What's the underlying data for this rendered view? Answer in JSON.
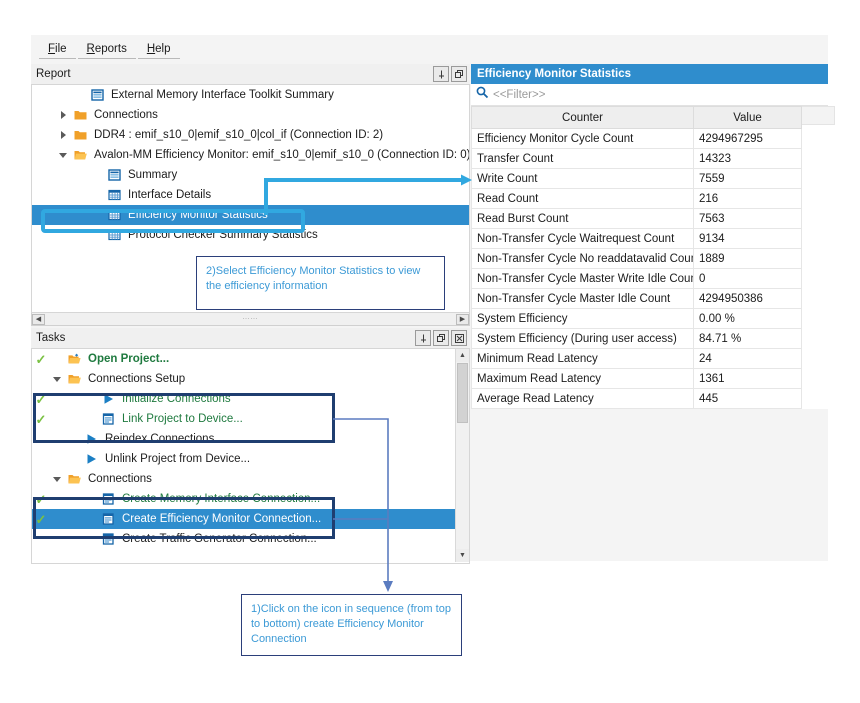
{
  "menu": {
    "items": [
      {
        "label": "File",
        "accel": "F"
      },
      {
        "label": "Reports",
        "accel": "R"
      },
      {
        "label": "Help",
        "accel": "H"
      }
    ]
  },
  "report_panel": {
    "title": "Report",
    "buttons": [
      {
        "name": "pin-icon",
        "glyph": "⤓"
      },
      {
        "name": "restore-icon",
        "glyph": "⧉"
      }
    ],
    "tree": [
      {
        "label": "External Memory Interface Toolkit Summary",
        "icon": "summary-icon",
        "indent": 2,
        "twisty": "none",
        "selected": false
      },
      {
        "label": "Connections",
        "icon": "folder-icon",
        "indent": 1,
        "twisty": "closed",
        "selected": false
      },
      {
        "label": "DDR4 : emif_s10_0|emif_s10_0|col_if (Connection ID: 2)",
        "icon": "folder-icon",
        "indent": 1,
        "twisty": "closed",
        "selected": false
      },
      {
        "label": "Avalon-MM Efficiency Monitor: emif_s10_0|emif_s10_0 (Connection ID: 0)",
        "icon": "folder-open-icon",
        "indent": 1,
        "twisty": "open",
        "selected": false
      },
      {
        "label": "Summary",
        "icon": "summary-icon",
        "indent": 3,
        "twisty": "none",
        "selected": false
      },
      {
        "label": "Interface Details",
        "icon": "table-icon",
        "indent": 3,
        "twisty": "none",
        "selected": false
      },
      {
        "label": "Efficiency Monitor Statistics",
        "icon": "table-icon",
        "indent": 3,
        "twisty": "none",
        "selected": true
      },
      {
        "label": "Protocol Checker Summary Statistics",
        "icon": "table-icon",
        "indent": 3,
        "twisty": "none",
        "selected": false
      }
    ]
  },
  "tasks_panel": {
    "title": "Tasks",
    "buttons": [
      {
        "name": "pin-icon",
        "glyph": "⤓"
      },
      {
        "name": "restore-icon",
        "glyph": "⧉"
      },
      {
        "name": "close-icon",
        "glyph": "☒"
      }
    ],
    "rows": [
      {
        "label": "Open Project...",
        "icon": "open-project-icon",
        "indent": 1,
        "check": true,
        "twisty": "none",
        "green": true,
        "bold": true,
        "selected": false
      },
      {
        "label": "Connections Setup",
        "icon": "folder-open-icon",
        "indent": 1,
        "check": false,
        "twisty": "open",
        "green": false,
        "bold": false,
        "selected": false
      },
      {
        "label": "Initialize Connections",
        "icon": "run-icon",
        "indent": 3,
        "check": true,
        "twisty": "none",
        "green": true,
        "bold": false,
        "selected": false
      },
      {
        "label": "Link Project to Device...",
        "icon": "dialog-icon",
        "indent": 3,
        "check": true,
        "twisty": "none",
        "green": true,
        "bold": false,
        "selected": false
      },
      {
        "label": "Reindex Connections",
        "icon": "run-icon",
        "indent": 2,
        "check": false,
        "twisty": "none",
        "green": false,
        "bold": false,
        "selected": false
      },
      {
        "label": "Unlink Project from Device...",
        "icon": "run-icon",
        "indent": 2,
        "check": false,
        "twisty": "none",
        "green": false,
        "bold": false,
        "selected": false
      },
      {
        "label": "Connections",
        "icon": "folder-open-icon",
        "indent": 1,
        "check": false,
        "twisty": "open",
        "green": false,
        "bold": false,
        "selected": false
      },
      {
        "label": "Create Memory Interface Connection...",
        "icon": "dialog-icon",
        "indent": 3,
        "check": true,
        "twisty": "none",
        "green": true,
        "bold": false,
        "selected": false
      },
      {
        "label": "Create Efficiency Monitor Connection...",
        "icon": "dialog-icon",
        "indent": 3,
        "check": true,
        "twisty": "none",
        "green": false,
        "bold": false,
        "selected": true
      },
      {
        "label": "Create Traffic Generator Connection...",
        "icon": "dialog-icon",
        "indent": 3,
        "check": false,
        "twisty": "none",
        "green": false,
        "bold": false,
        "selected": false
      }
    ]
  },
  "stats_panel": {
    "title": "Efficiency Monitor Statistics",
    "filter_placeholder": "<<Filter>>",
    "columns": [
      "Counter",
      "Value"
    ],
    "rows": [
      {
        "counter": "Efficiency Monitor Cycle Count",
        "value": "4294967295"
      },
      {
        "counter": "Transfer Count",
        "value": "14323"
      },
      {
        "counter": "Write Count",
        "value": "7559"
      },
      {
        "counter": "Read Count",
        "value": "216"
      },
      {
        "counter": "Read Burst Count",
        "value": "7563"
      },
      {
        "counter": "Non-Transfer Cycle Waitrequest Count",
        "value": "9134"
      },
      {
        "counter": "Non-Transfer Cycle No readdatavalid Count",
        "value": "1889"
      },
      {
        "counter": "Non-Transfer Cycle Master Write Idle Count",
        "value": "0"
      },
      {
        "counter": "Non-Transfer Cycle Master Idle Count",
        "value": "4294950386"
      },
      {
        "counter": "System Efficiency",
        "value": "0.00 %"
      },
      {
        "counter": "System Efficiency (During user access)",
        "value": "84.71 %"
      },
      {
        "counter": "Minimum Read Latency",
        "value": "24"
      },
      {
        "counter": "Maximum Read Latency",
        "value": "1361"
      },
      {
        "counter": "Average Read Latency",
        "value": "445"
      }
    ]
  },
  "annotations": {
    "callout_step2": "2)Select Efficiency Monitor Statistics  to view the efficiency information",
    "callout_step1": "1)Click on the icon in sequence (from top to bottom) create Efficiency Monitor Connection"
  },
  "colors": {
    "selection_blue": "#2f8dcd",
    "highlight_cyan": "#31a8e0",
    "annotation_navy": "#1f3e70",
    "annotation_text": "#3c9ad6",
    "check_green": "#7ac143",
    "task_green": "#1f7a3f",
    "folder_orange": "#f0a029"
  }
}
